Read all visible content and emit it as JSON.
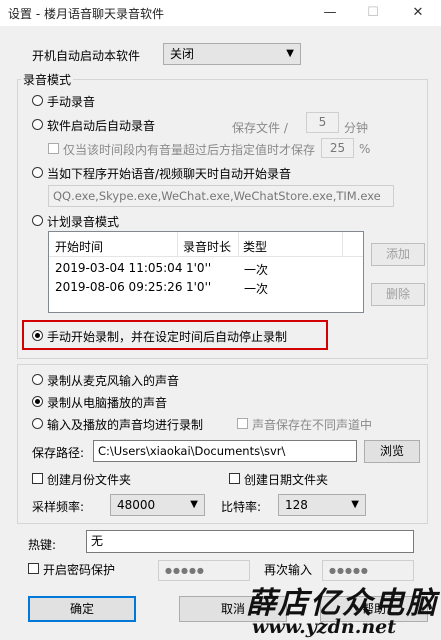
{
  "window": {
    "title": "设置 - 楼月语音聊天录音软件",
    "minimize": "—",
    "maximize": "☐",
    "close": "✕"
  },
  "startup": {
    "label": "开机自动启动本软件",
    "value": "关闭"
  },
  "record_mode": {
    "title": "录音模式",
    "manual": "手动录音",
    "auto_after_start": "软件启动后自动录音",
    "save_file_label": "保存文件 /",
    "save_minutes": "5",
    "minutes_unit": "分钟",
    "volume_save_label": "仅当该时间段内有音量超过后方指定值时才保存",
    "volume_percent": "25",
    "percent_unit": "%",
    "auto_program": "当如下程序开始语音/视频聊天时自动开始录音",
    "program_list": "QQ.exe,Skype.exe,WeChat.exe,WeChatStore.exe,TIM.exe",
    "scheduled": "计划录音模式",
    "columns": [
      "开始时间",
      "录音时长",
      "类型"
    ],
    "rows": [
      {
        "start": "2019-03-04 11:05:04",
        "duration": "1'0''",
        "type": "一次"
      },
      {
        "start": "2019-08-06 09:25:26",
        "duration": "1'0''",
        "type": "一次"
      }
    ],
    "add": "添加",
    "delete": "删除",
    "manual_timed": "手动开始录制，并在设定时间后自动停止录制"
  },
  "source": {
    "mic": "录制从麦克风输入的声音",
    "pc": "录制从电脑播放的声音",
    "both": "输入及播放的声音均进行录制",
    "separate_channels": "声音保存在不同声道中",
    "save_path_label": "保存路径:",
    "save_path": "C:\\Users\\xiaokai\\Documents\\svr\\",
    "browse": "浏览",
    "monthly_folder": "创建月份文件夹",
    "date_folder": "创建日期文件夹",
    "sample_rate_label": "采样频率:",
    "sample_rate": "48000",
    "bitrate_label": "比特率:",
    "bitrate": "128"
  },
  "hotkey": {
    "label": "热键:",
    "value": "无"
  },
  "password": {
    "label": "开启密码保护",
    "pw": "●●●●●",
    "again_label": "再次输入",
    "pw2": "●●●●●"
  },
  "buttons": {
    "ok": "确定",
    "cancel": "取消",
    "help": "帮助"
  },
  "watermark": {
    "text": "薛店亿众电脑",
    "url": "www.yzdn.net"
  },
  "colors": {
    "highlight": "#d40000",
    "selected_row": "#cce8ff"
  }
}
